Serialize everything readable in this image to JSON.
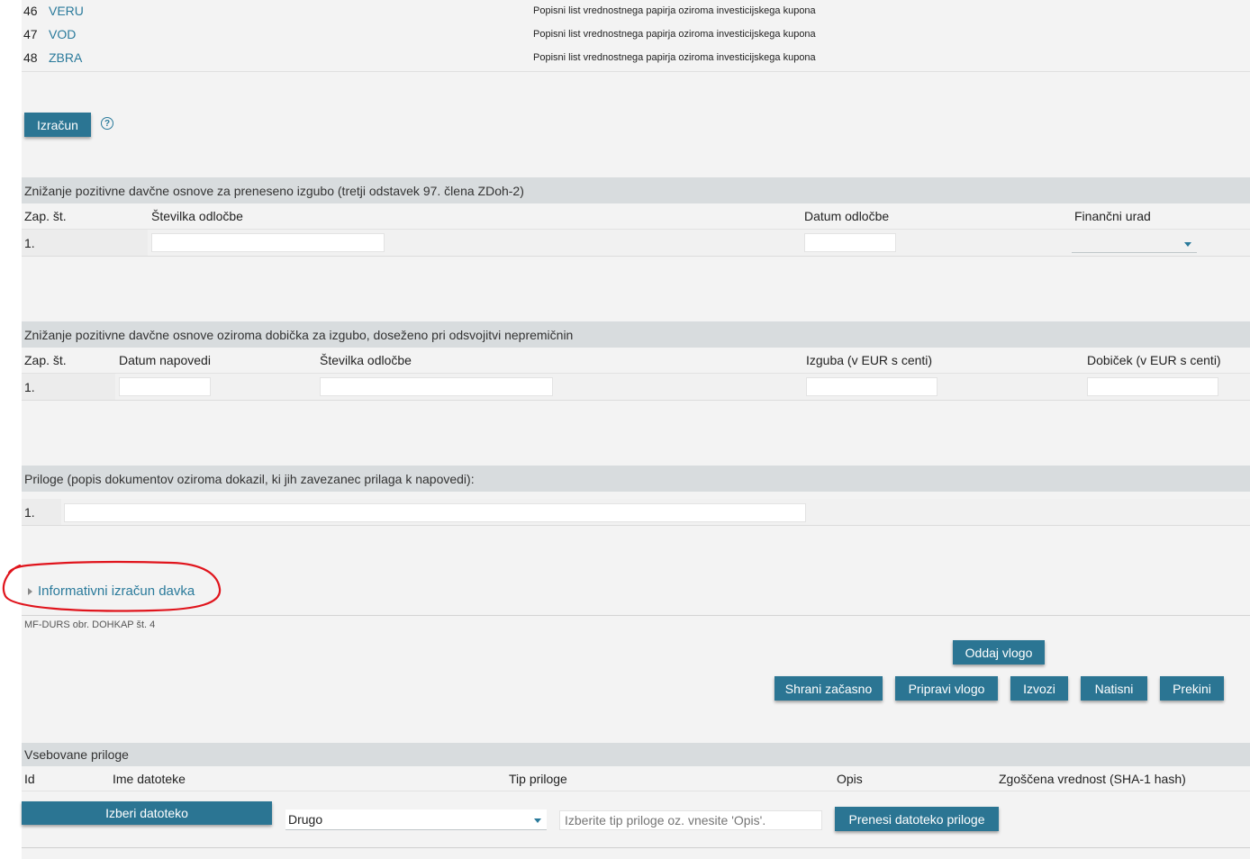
{
  "top_list": [
    {
      "num": "46",
      "code": "VERU",
      "desc": "Popisni list vrednostnega papirja oziroma investicijskega kupona"
    },
    {
      "num": "47",
      "code": "VOD",
      "desc": "Popisni list vrednostnega papirja oziroma investicijskega kupona"
    },
    {
      "num": "48",
      "code": "ZBRA",
      "desc": "Popisni list vrednostnega papirja oziroma investicijskega kupona"
    }
  ],
  "calc": {
    "button": "Izračun",
    "help_icon": "question-circle-icon"
  },
  "section1": {
    "title": "Znižanje pozitivne davčne osnove za preneseno izgubo (tretji odstavek 97. člena ZDoh-2)",
    "headers": [
      "Zap. št.",
      "Številka odločbe",
      "Datum odločbe",
      "Finančni urad"
    ],
    "row_num": "1."
  },
  "section2": {
    "title": "Znižanje pozitivne davčne osnove oziroma dobička za izgubo, doseženo pri odsvojitvi nepremičnin",
    "headers": [
      "Zap. št.",
      "Datum napovedi",
      "Številka odločbe",
      "Izguba (v EUR s centi)",
      "Dobiček (v EUR s centi)"
    ],
    "row_num": "1."
  },
  "section3": {
    "title": "Priloge (popis dokumentov oziroma dokazil, ki jih zavezanec prilaga k napovedi):",
    "row_num": "1."
  },
  "info_calc": {
    "label": "Informativni izračun davka",
    "icon": "triangle-right-icon",
    "annotation_color": "#e0141c"
  },
  "form_code": "MF-DURS obr. DOHKAP št. 4",
  "actions": {
    "submit": "Oddaj vlogo",
    "save": "Shrani začasno",
    "prepare": "Pripravi vlogo",
    "export": "Izvozi",
    "print": "Natisni",
    "cancel": "Prekini"
  },
  "attachments": {
    "title": "Vsebovane priloge",
    "headers": [
      "Id",
      "Ime datoteke",
      "Tip priloge",
      "Opis",
      "Zgoščena vrednost (SHA-1 hash)"
    ],
    "choose_file": "Izberi datoteko",
    "type_value": "Drugo",
    "desc_placeholder": "Izberite tip priloge oz. vnesite 'Opis'.",
    "upload": "Prenesi datoteko priloge"
  },
  "colors": {
    "accent": "#2b7593",
    "link": "#2a7a9b",
    "section_bg": "#d8dcde",
    "page_bg": "#f3f3f3"
  }
}
